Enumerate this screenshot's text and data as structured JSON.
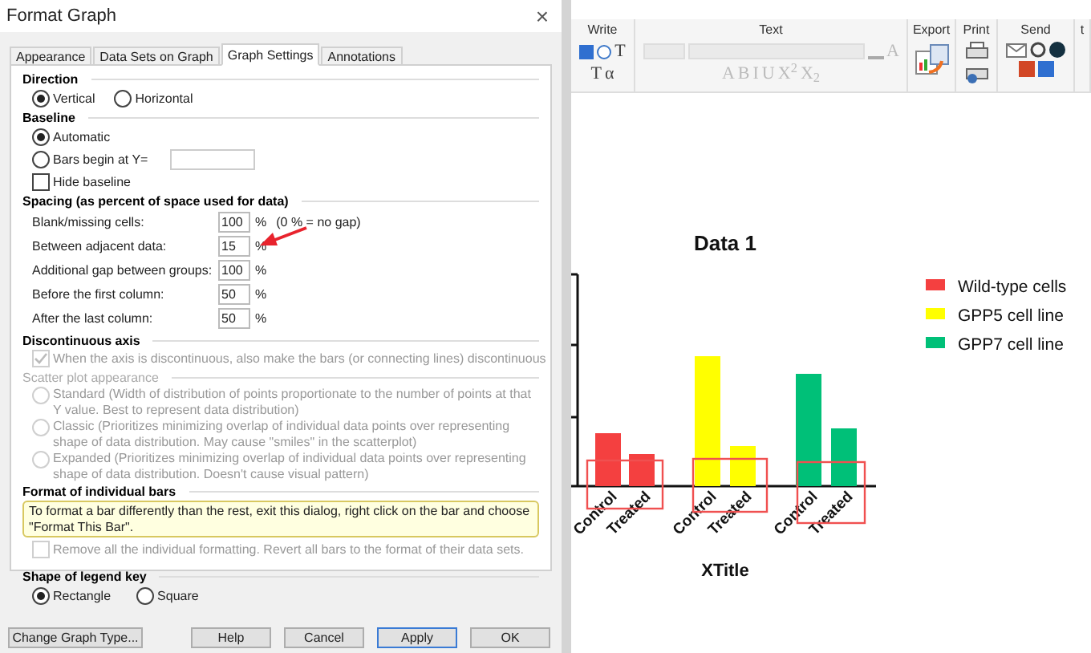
{
  "dialog": {
    "title": "Format Graph",
    "close": "×",
    "tabs": [
      {
        "label": "Appearance",
        "selected": false
      },
      {
        "label": "Data Sets on Graph",
        "selected": false
      },
      {
        "label": "Graph Settings",
        "selected": true
      },
      {
        "label": "Annotations",
        "selected": false
      }
    ],
    "direction": {
      "heading": "Direction",
      "options": [
        {
          "label": "Vertical",
          "selected": true
        },
        {
          "label": "Horizontal",
          "selected": false
        }
      ]
    },
    "baseline": {
      "heading": "Baseline",
      "options": [
        {
          "label": "Automatic",
          "selected": true
        },
        {
          "label": "Bars begin at Y=",
          "selected": false
        }
      ],
      "hide_baseline": {
        "label": "Hide baseline",
        "checked": false
      }
    },
    "spacing": {
      "heading": "Spacing (as percent of space used for data)",
      "rows": [
        {
          "label": "Blank/missing cells:",
          "value": "100",
          "unit": "%",
          "note": "(0 % = no gap)"
        },
        {
          "label": "Between adjacent data:",
          "value": "15",
          "unit": "%"
        },
        {
          "label": "Additional gap between groups:",
          "value": "100",
          "unit": "%"
        },
        {
          "label": "Before the first column:",
          "value": "50",
          "unit": "%"
        },
        {
          "label": "After the last column:",
          "value": "50",
          "unit": "%"
        }
      ]
    },
    "discontinuous": {
      "heading": "Discontinuous axis",
      "option": {
        "label": "When the axis is discontinuous, also make the bars (or connecting lines) discontinuous",
        "checked": true,
        "disabled": true
      }
    },
    "scatter": {
      "heading": "Scatter plot appearance",
      "disabled": true,
      "options": [
        {
          "label": "Standard (Width of distribution of points proportionate to the number of points at that Y value. Best to represent data distribution)",
          "selected": false
        },
        {
          "label": "Classic (Prioritizes minimizing overlap of individual data points over representing shape of data distribution. May cause \"smiles\" in the scatterplot)",
          "selected": false
        },
        {
          "label": "Expanded (Prioritizes minimizing overlap of individual data points over representing shape of data distribution. Doesn't cause visual pattern)",
          "selected": false
        }
      ]
    },
    "individual": {
      "heading": "Format of individual bars",
      "note": "To format a bar differently than the rest, exit this dialog, right click on the bar and choose \"Format This Bar\".",
      "option": {
        "label": "Remove all the individual formatting. Revert all bars to the format of their data sets.",
        "checked": false,
        "disabled": true
      }
    },
    "legend_shape": {
      "heading": "Shape of legend key",
      "options": [
        {
          "label": "Rectangle",
          "selected": true
        },
        {
          "label": "Square",
          "selected": false
        }
      ]
    },
    "buttons": [
      {
        "label": "Change Graph Type...",
        "default": false
      },
      {
        "label": "Help",
        "default": false
      },
      {
        "label": "Cancel",
        "default": false
      },
      {
        "label": "Apply",
        "default": true
      },
      {
        "label": "OK",
        "default": false
      }
    ]
  },
  "toolbar": {
    "groups": [
      {
        "label": "Write",
        "tools": [
          "T",
          "T",
          "α"
        ]
      },
      {
        "label": "Text",
        "tools": [
          "A",
          "A",
          "B",
          "I",
          "U",
          "X$^{2}$",
          "X$_{2}$"
        ]
      },
      {
        "label": "Export"
      },
      {
        "label": "Print"
      },
      {
        "label": "Send"
      },
      {
        "label": "t"
      }
    ]
  },
  "graph": {
    "title": "Data 1",
    "x_title": "XTitle",
    "legend": [
      {
        "label": "Wild-type cells",
        "color": "#f44040"
      },
      {
        "label": "GPP5 cell line",
        "color": "#ffff00"
      },
      {
        "label": "GPP7 cell line",
        "color": "#00c078"
      }
    ],
    "groups": [
      {
        "labels": [
          "Control",
          "Treated"
        ],
        "color": "#f44040"
      },
      {
        "labels": [
          "Control",
          "Treated"
        ],
        "color": "#ffff00"
      },
      {
        "labels": [
          "Control",
          "Treated"
        ],
        "color": "#00c078"
      }
    ]
  }
}
